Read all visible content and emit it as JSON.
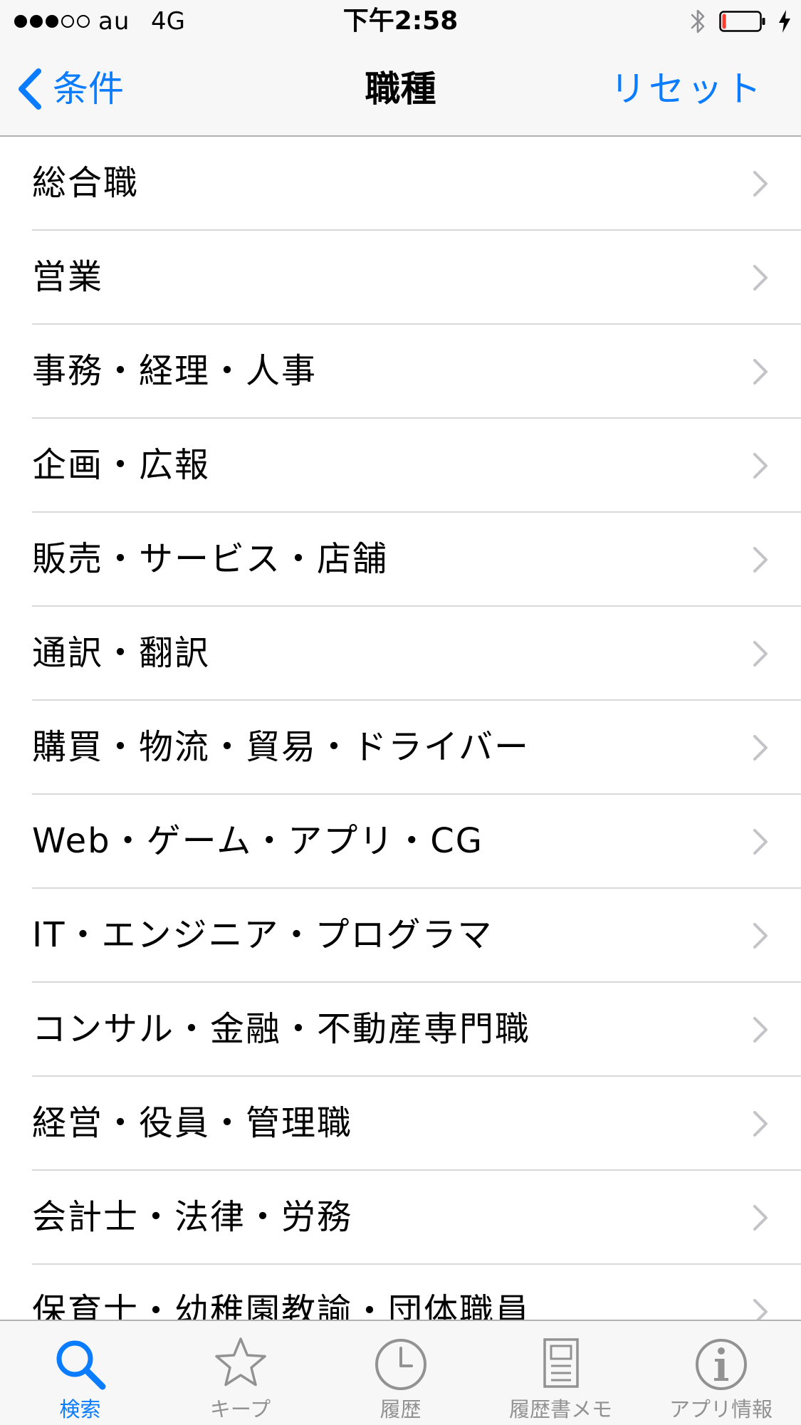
{
  "status_bar": {
    "carrier": "au",
    "network": "4G",
    "time": "下午2:58",
    "signal_bars_filled": 3,
    "signal_bars_total": 5,
    "battery_level": 0.1,
    "battery_color": "#ff3b30"
  },
  "nav": {
    "back_label": "条件",
    "title": "職種",
    "reset_label": "リセット"
  },
  "colors": {
    "accent": "#0a7cff",
    "inactive_tab": "#929292"
  },
  "list": {
    "items": [
      {
        "label": "総合職"
      },
      {
        "label": "営業"
      },
      {
        "label": "事務・経理・人事"
      },
      {
        "label": "企画・広報"
      },
      {
        "label": "販売・サービス・店舗"
      },
      {
        "label": "通訳・翻訳"
      },
      {
        "label": "購買・物流・貿易・ドライバー"
      },
      {
        "label": "Web・ゲーム・アプリ・CG"
      },
      {
        "label": "IT・エンジニア・プログラマ"
      },
      {
        "label": "コンサル・金融・不動産専門職"
      },
      {
        "label": "経営・役員・管理職"
      },
      {
        "label": "会計士・法律・労務"
      },
      {
        "label": "保育士・幼稚園教諭・団体職員"
      }
    ]
  },
  "tabs": [
    {
      "label": "検索",
      "icon": "search-icon",
      "active": true
    },
    {
      "label": "キープ",
      "icon": "star-icon",
      "active": false
    },
    {
      "label": "履歴",
      "icon": "clock-icon",
      "active": false
    },
    {
      "label": "履歴書メモ",
      "icon": "memo-icon",
      "active": false
    },
    {
      "label": "アプリ情報",
      "icon": "info-icon",
      "active": false
    }
  ]
}
